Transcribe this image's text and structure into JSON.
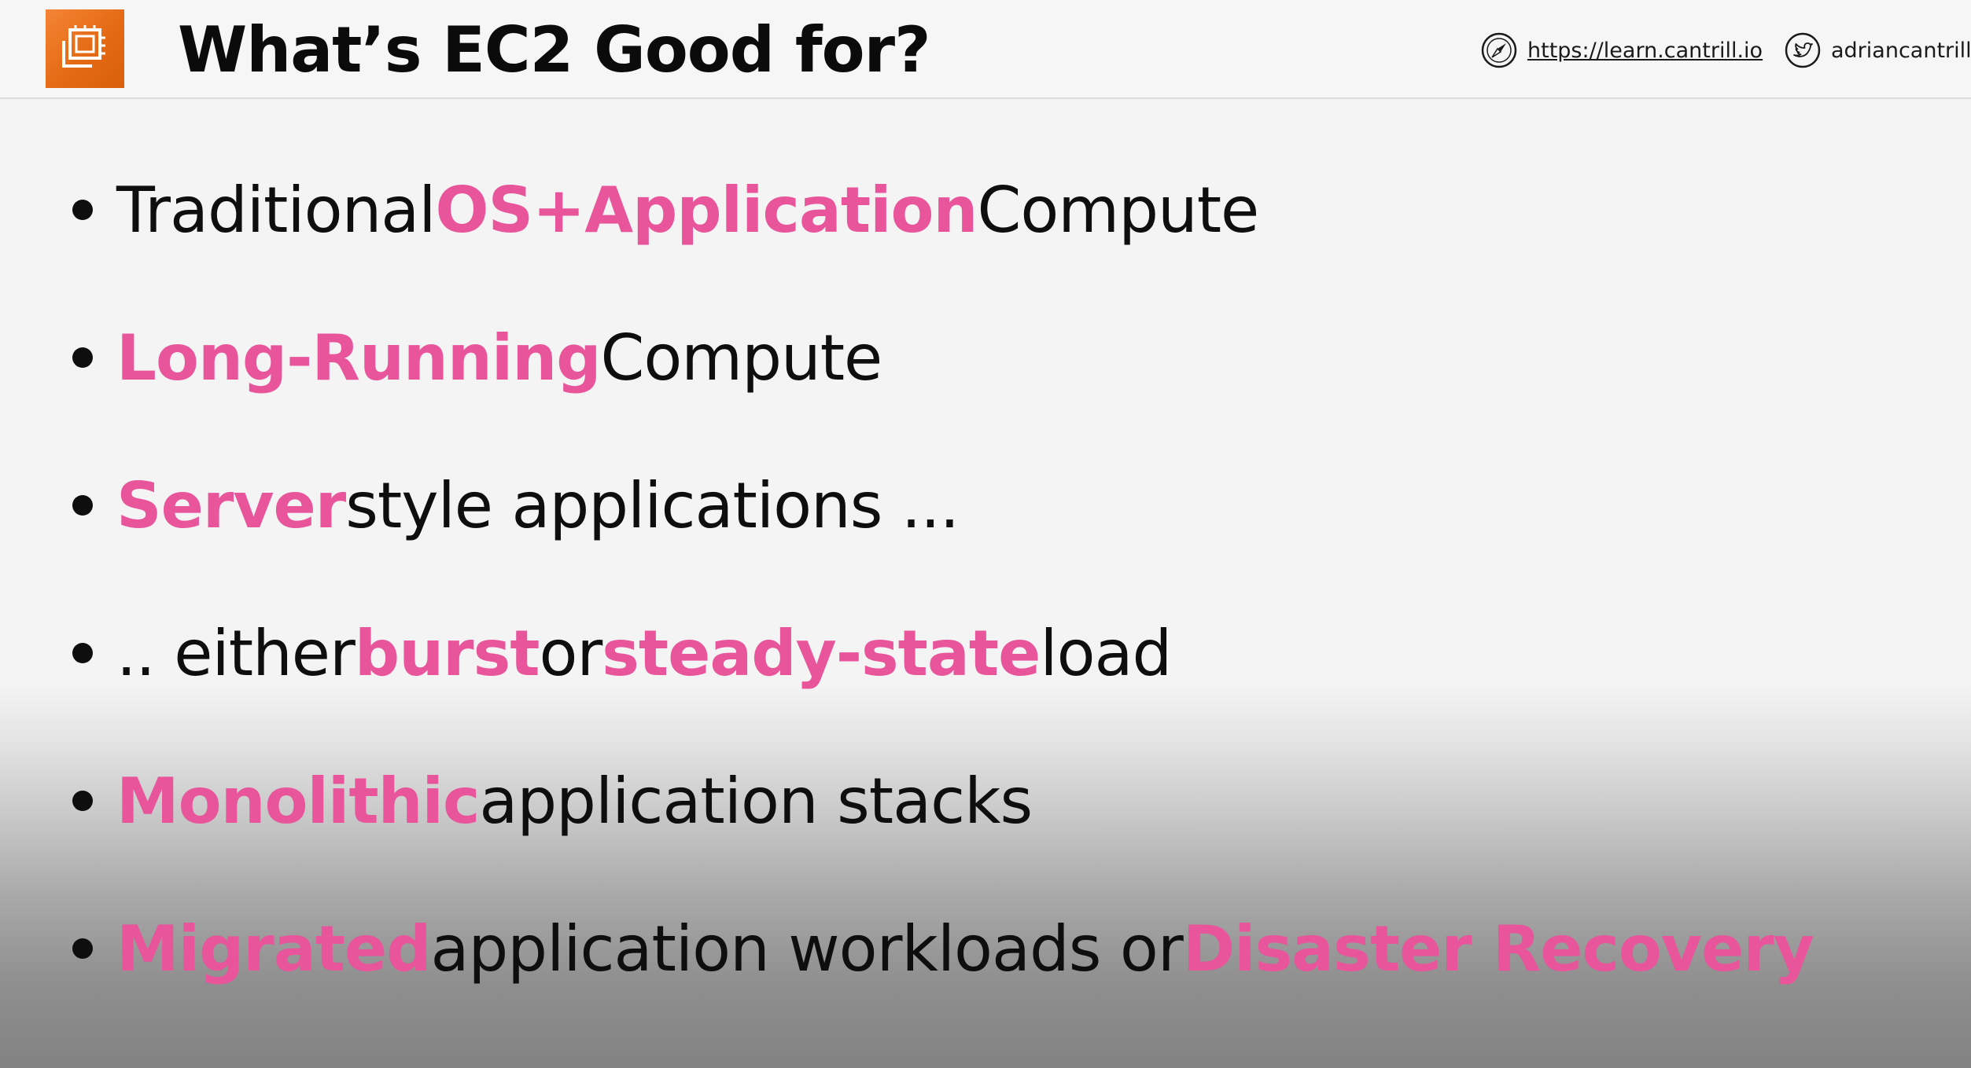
{
  "header": {
    "title": "What’s EC2 Good for?",
    "logo_icon": "ec2-chip-icon",
    "website": "https://learn.cantrill.io",
    "website_icon": "compass-icon",
    "twitter": "adriancantrill",
    "twitter_icon": "twitter-bird-icon"
  },
  "colors": {
    "accent": "#e8559b",
    "logo_orange": "#e46a14",
    "text": "#0e0e0e"
  },
  "bullets": [
    {
      "parts": [
        "Traditional ",
        "OS+Application",
        " Compute"
      ]
    },
    {
      "parts": [
        "Long-Running",
        " Compute"
      ]
    },
    {
      "parts": [
        "Server",
        " style applications ..."
      ]
    },
    {
      "parts": [
        ".. either ",
        "burst",
        " or ",
        "steady-state",
        " load"
      ]
    },
    {
      "parts": [
        "Monolithic",
        " application stacks"
      ]
    },
    {
      "parts": [
        "Migrated",
        " application workloads or ",
        "Disaster Recovery"
      ]
    }
  ]
}
